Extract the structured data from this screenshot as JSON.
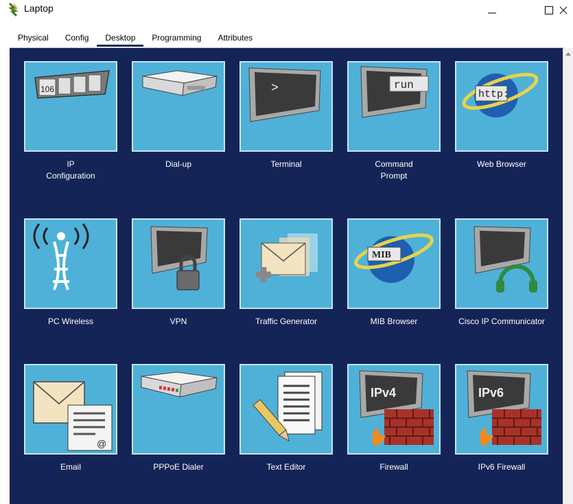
{
  "window": {
    "title": "Laptop",
    "app_icon": "laptop-tree-icon",
    "controls": [
      "minimize-icon",
      "maximize-icon",
      "close-icon"
    ]
  },
  "tabs": [
    {
      "label": "Physical",
      "active": false
    },
    {
      "label": "Config",
      "active": false
    },
    {
      "label": "Desktop",
      "active": true
    },
    {
      "label": "Programming",
      "active": false
    },
    {
      "label": "Attributes",
      "active": false
    }
  ],
  "desktop": {
    "background": "#142456",
    "tile_color": "#4fb1d8",
    "apps": [
      {
        "label": "IP\nConfiguration",
        "icon": "ip-configuration-icon",
        "tile_text": "106"
      },
      {
        "label": "Dial-up",
        "icon": "dialup-modem-icon"
      },
      {
        "label": "Terminal",
        "icon": "terminal-icon",
        "tile_text": ">"
      },
      {
        "label": "Command\nPrompt",
        "icon": "command-prompt-icon",
        "tile_text": "run"
      },
      {
        "label": "Web Browser",
        "icon": "web-browser-icon",
        "tile_text": "http:"
      },
      {
        "label": "PC Wireless",
        "icon": "wireless-tower-icon"
      },
      {
        "label": "VPN",
        "icon": "vpn-lock-icon"
      },
      {
        "label": "Traffic Generator",
        "icon": "traffic-generator-icon"
      },
      {
        "label": "MIB Browser",
        "icon": "mib-browser-icon",
        "tile_text": "MIB"
      },
      {
        "label": "Cisco IP Communicator",
        "icon": "ip-communicator-headset-icon"
      },
      {
        "label": "Email",
        "icon": "email-envelope-icon",
        "tile_text": "@"
      },
      {
        "label": "PPPoE Dialer",
        "icon": "pppoe-dialer-icon"
      },
      {
        "label": "Text Editor",
        "icon": "text-editor-pencil-icon"
      },
      {
        "label": "Firewall",
        "icon": "firewall-ipv4-icon",
        "tile_text": "IPv4"
      },
      {
        "label": "IPv6 Firewall",
        "icon": "firewall-ipv6-icon",
        "tile_text": "IPv6"
      }
    ]
  }
}
